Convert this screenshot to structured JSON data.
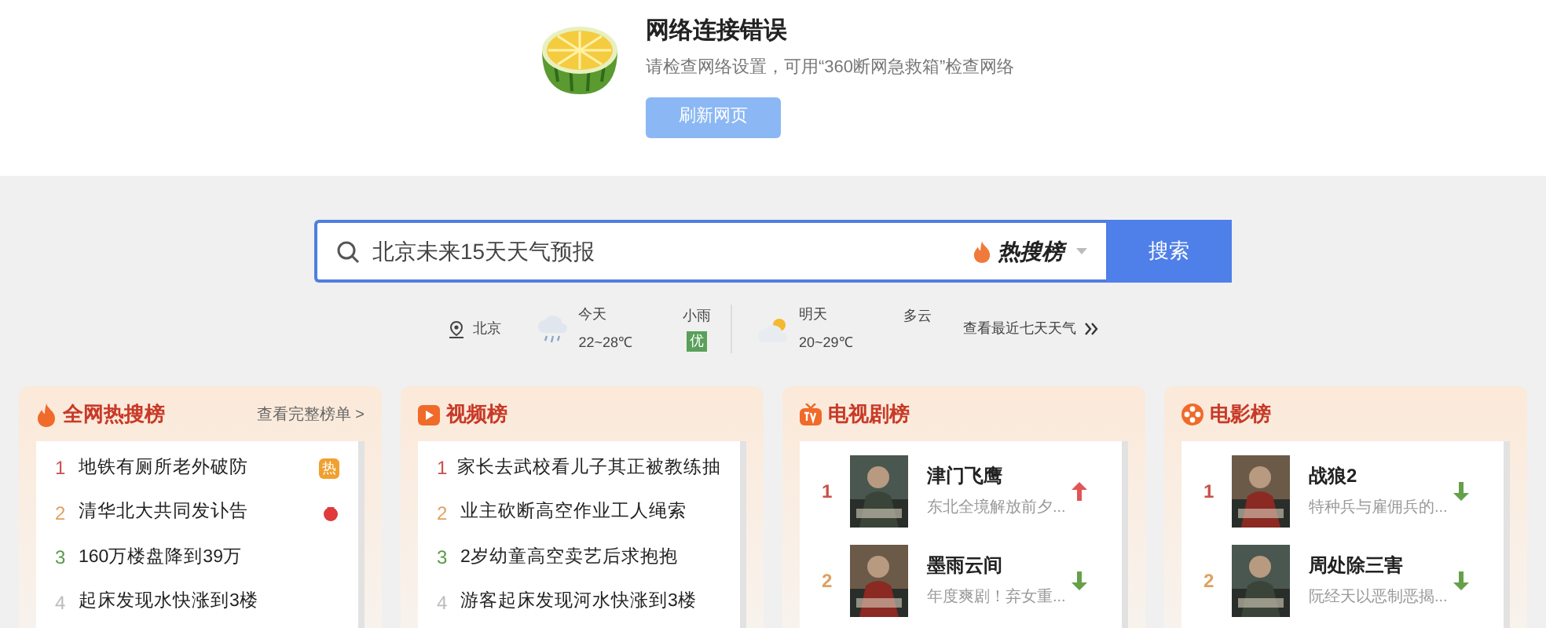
{
  "error": {
    "title": "网络连接错误",
    "message": "请检查网络设置，可用“360断网急救箱”检查网络",
    "button": "刷新网页"
  },
  "search": {
    "value": "北京未来15天天气预报",
    "hot_label": "热搜榜",
    "button": "搜索"
  },
  "weather": {
    "city": "北京",
    "days": [
      {
        "label": "今天",
        "temp": "22~28℃",
        "condition": "小雨",
        "kind": "rain",
        "aqi": "优"
      },
      {
        "label": "明天",
        "temp": "20~29℃",
        "condition": "多云",
        "kind": "cloudy"
      }
    ],
    "more": "查看最近七天天气"
  },
  "panels": [
    {
      "kind": "text",
      "title": "全网热搜榜",
      "link": "查看完整榜单 >",
      "items": [
        {
          "rank": "1",
          "title": "地铁有厕所老外破防",
          "badge": {
            "kind": "text",
            "text": "热"
          }
        },
        {
          "rank": "2",
          "title": "清华北大共同发讣告",
          "badge": {
            "kind": "icon"
          }
        },
        {
          "rank": "3",
          "title": "160万楼盘降到39万"
        },
        {
          "rank": "4",
          "title": "起床发现水快涨到3楼"
        }
      ]
    },
    {
      "kind": "text",
      "title": "视频榜",
      "items": [
        {
          "rank": "1",
          "title": "家长去武校看儿子其正被教练抽"
        },
        {
          "rank": "2",
          "title": "业主砍断高空作业工人绳索"
        },
        {
          "rank": "3",
          "title": "2岁幼童高空卖艺后求抱抱"
        },
        {
          "rank": "4",
          "title": "游客起床发现河水快涨到3楼"
        }
      ]
    },
    {
      "kind": "media",
      "title": "电视剧榜",
      "items": [
        {
          "rank": "1",
          "title": "津门飞鹰",
          "desc": "东北全境解放前夕...",
          "rising": true
        },
        {
          "rank": "2",
          "title": "墨雨云间",
          "desc": "年度爽剧！弃女重...",
          "rising": false
        }
      ]
    },
    {
      "kind": "media",
      "title": "电影榜",
      "items": [
        {
          "rank": "1",
          "title": "战狼2",
          "desc": "特种兵与雇佣兵的...",
          "rising": false
        },
        {
          "rank": "2",
          "title": "周处除三害",
          "desc": "阮经天以恶制恶揭...",
          "rising": false
        }
      ]
    }
  ]
}
